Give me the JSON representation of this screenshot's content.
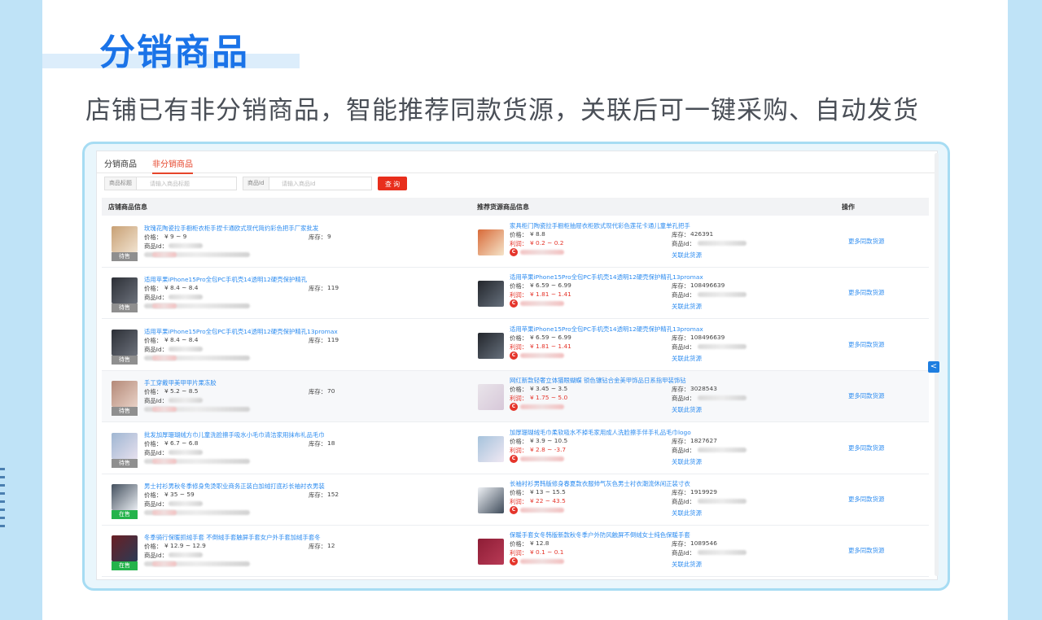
{
  "hero": {
    "title": "分销商品",
    "subtitle": "店铺已有非分销商品，智能推荐同款货源，关联后可一键采购、自动发货"
  },
  "tabs": [
    {
      "label": "分销商品"
    },
    {
      "label": "非分销商品"
    }
  ],
  "filters": {
    "title_label": "商品标题",
    "title_placeholder": "请输入商品标题",
    "id_label": "商品Id",
    "id_placeholder": "请输入商品Id",
    "query_label": "查 询"
  },
  "table_headers": {
    "shop": "店铺商品信息",
    "recommend": "推荐货源商品信息",
    "action": "操作"
  },
  "labels": {
    "price": "价格：",
    "stock": "库存：",
    "product_id": "商品Id：",
    "profit": "利润：",
    "more_sources": "更多同款货源",
    "link_source": "关联此货源"
  },
  "rows": [
    {
      "shop_title": "玫瑰花陶瓷拉手橱柜衣柜手捏卡通欧式现代简约彩色把手厂家批发",
      "shop_price": "¥ 9 ~ 9",
      "shop_stock": "9",
      "status": "待售",
      "rec_title": "家具柜门陶瓷拉手橱柜抽屉衣柜欧式现代彩色莲花卡通儿童单孔把手",
      "rec_price": "¥ 8.8",
      "rec_profit": "¥ 0.2 ~ 0.2",
      "rec_stock": "426391"
    },
    {
      "shop_title": "适用苹果iPhone15Pro全包PC手机壳14透明12硬壳保护精孔",
      "shop_price": "¥ 8.4 ~ 8.4",
      "shop_stock": "119",
      "status": "待售",
      "rec_title": "适用苹果iPhone15Pro全包PC手机壳14透明12硬壳保护精孔13promax",
      "rec_price": "¥ 6.59 ~ 6.99",
      "rec_profit": "¥ 1.81 ~ 1.41",
      "rec_stock": "108496639"
    },
    {
      "shop_title": "适用苹果iPhone15Pro全包PC手机壳14透明12硬壳保护精孔13promax",
      "shop_price": "¥ 8.4 ~ 8.4",
      "shop_stock": "119",
      "status": "待售",
      "rec_title": "适用苹果iPhone15Pro全包PC手机壳14透明12硬壳保护精孔13promax",
      "rec_price": "¥ 6.59 ~ 6.99",
      "rec_profit": "¥ 1.81 ~ 1.41",
      "rec_stock": "108496639"
    },
    {
      "shop_title": "手工穿戴甲美甲甲片果冻胶",
      "shop_price": "¥ 5.2 ~ 8.5",
      "shop_stock": "70",
      "status": "待售",
      "rec_title": "网红新款轻奢立体猫眼蝴蝶 锁色镶钻合金美甲饰品日系指甲装饰钻",
      "rec_price": "¥ 3.45 ~ 3.5",
      "rec_profit": "¥ 1.75 ~ 5.0",
      "rec_stock": "3028543"
    },
    {
      "shop_title": "批发加厚珊瑚绒方巾儿童洗脸擦手吸水小毛巾清洁家用抹布礼品毛巾",
      "shop_price": "¥ 6.7 ~ 6.8",
      "shop_stock": "18",
      "status": "待售",
      "rec_title": "加厚珊瑚绒毛巾柔软吸水不掉毛家用成人洗脸擦手伴手礼品毛巾logo",
      "rec_price": "¥ 3.9 ~ 10.5",
      "rec_profit": "¥ 2.8 ~ -3.7",
      "rec_stock": "1827627"
    },
    {
      "shop_title": "男士衬衫男秋冬季修身免烫职业商务正装白加绒打底衫长袖衬衣男装",
      "shop_price": "¥ 35 ~ 59",
      "shop_stock": "152",
      "status": "在售",
      "rec_title": "长袖衬衫男韩版修身春夏款衣服帅气灰色男士衬衣潮流休闲正装寸衣",
      "rec_price": "¥ 13 ~ 15.5",
      "rec_profit": "¥ 22 ~ 43.5",
      "rec_stock": "1919929"
    },
    {
      "shop_title": "冬季骑行保暖抓绒手套 不倒绒手套触屏手套女户外手套加绒手套冬",
      "shop_price": "¥ 12.9 ~ 12.9",
      "shop_stock": "12",
      "status": "在售",
      "rec_title": "保暖手套女冬韩版新款秋冬季户外防风触屏不倒绒女士纯色保暖手套",
      "rec_price": "¥ 12.8",
      "rec_profit": "¥ 0.1 ~ 0.1",
      "rec_stock": "1089546"
    }
  ],
  "collapse_icon": "chevron-left-icon",
  "colors": {
    "accent": "#1a73e8",
    "link": "#2d8cf0",
    "danger": "#e5352b",
    "on_sale": "#24b34b",
    "waiting": "#8f8f8f"
  }
}
